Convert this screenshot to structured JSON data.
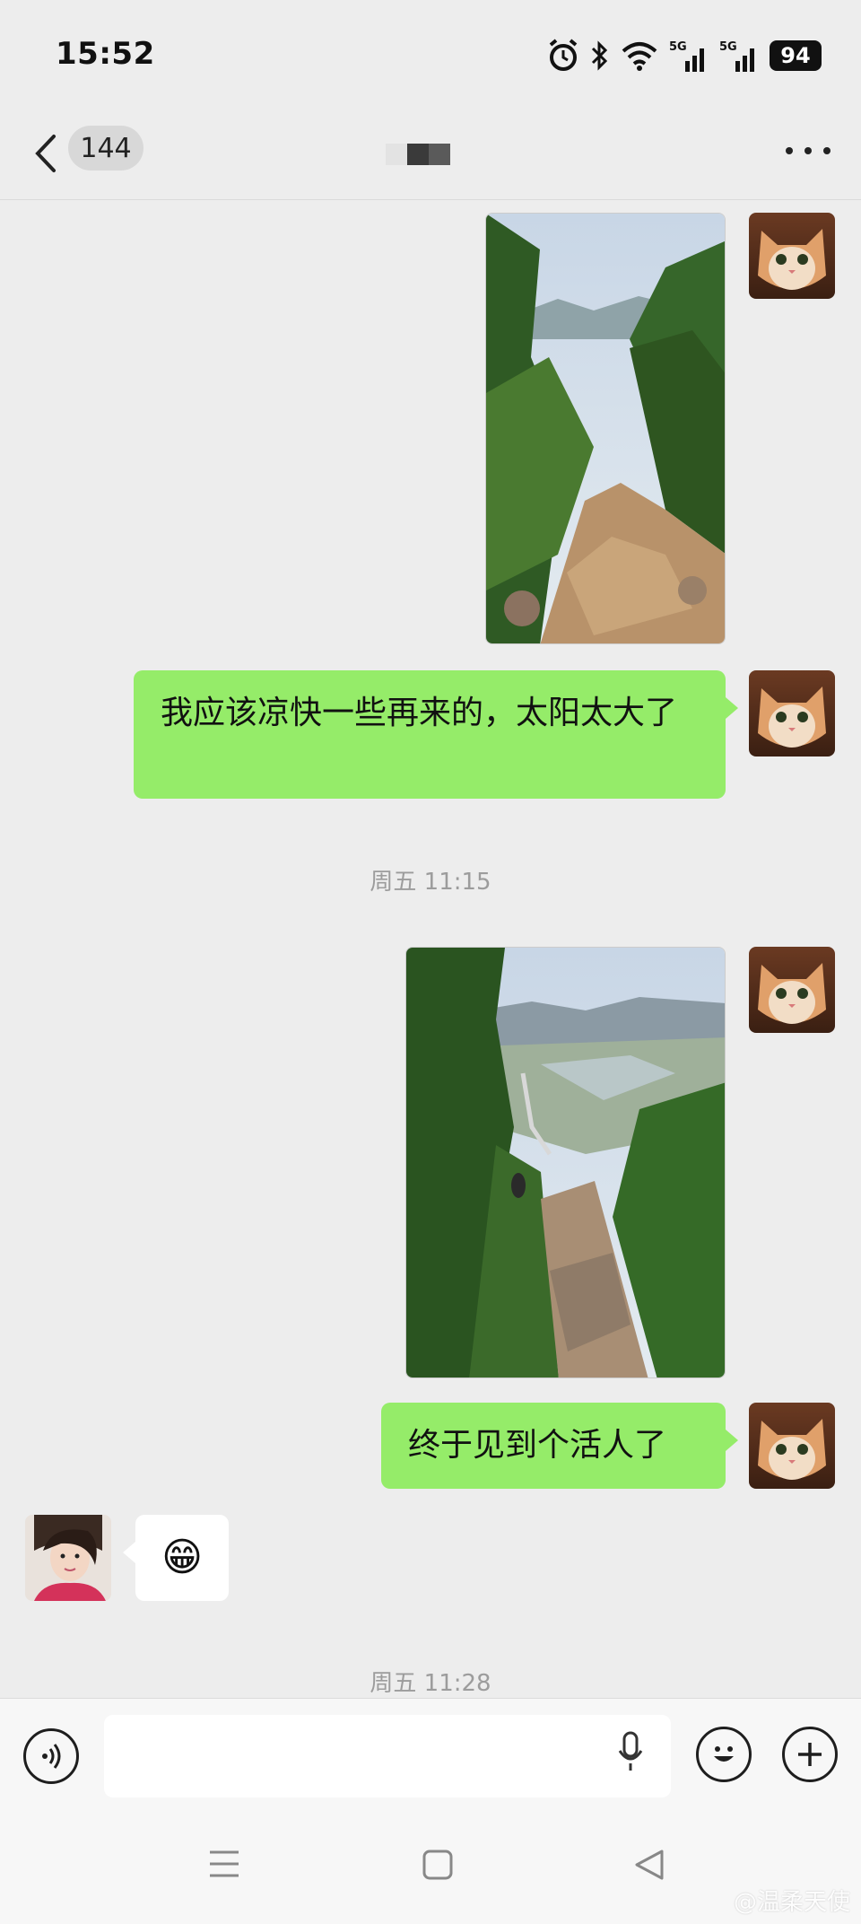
{
  "status_bar": {
    "time": "15:52",
    "battery": "94"
  },
  "header": {
    "unread_count": "144"
  },
  "messages": [
    {
      "type": "image",
      "from": "me",
      "description": "mountain-trail-photo-1"
    },
    {
      "type": "text",
      "from": "me",
      "text": "我应该凉快一些再来的，太阳太大了"
    },
    {
      "type": "timestamp",
      "text": "周五 11:15"
    },
    {
      "type": "image",
      "from": "me",
      "description": "mountain-trail-photo-2"
    },
    {
      "type": "text",
      "from": "me",
      "text": "终于见到个活人了"
    },
    {
      "type": "emoji",
      "from": "other",
      "text": "😁"
    },
    {
      "type": "timestamp",
      "text": "周五 11:28"
    }
  ],
  "input": {
    "placeholder": ""
  },
  "watermark": "@温柔天使",
  "colors": {
    "background": "#ededed",
    "outgoing_bubble": "#95ec69",
    "incoming_bubble": "#ffffff"
  }
}
